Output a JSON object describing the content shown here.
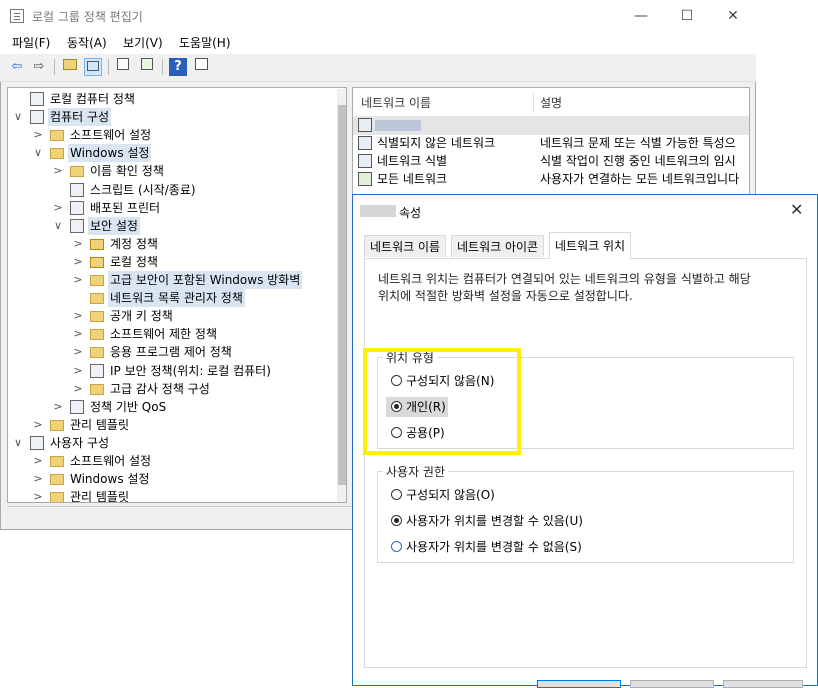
{
  "window": {
    "title": "로컬 그룹 정책 편집기",
    "controls": {
      "minimize": "—",
      "maximize": "☐",
      "close": "✕"
    }
  },
  "menu": [
    "파일(F)",
    "동작(A)",
    "보기(V)",
    "도움말(H)"
  ],
  "toolbar": {
    "icons": [
      "back-icon",
      "forward-icon",
      "up-folder-icon",
      "show-hide-tree-icon",
      "properties-icon",
      "export-icon",
      "help-icon",
      "view-icon"
    ],
    "glyphs": {
      "back": "⇦",
      "forward": "⇨",
      "help": "?"
    }
  },
  "tree": {
    "items": [
      {
        "label": "로컬 컴퓨터 정책",
        "chevron": "",
        "icon": "policy-icon"
      },
      {
        "label": "컴퓨터 구성",
        "chevron": "∨",
        "icon": "computer-icon"
      },
      {
        "label": "소프트웨어 설정",
        "chevron": ">",
        "icon": "folder-icon"
      },
      {
        "label": "Windows 설정",
        "chevron": "∨",
        "icon": "folder-icon"
      },
      {
        "label": "이름 확인 정책",
        "chevron": ">",
        "icon": "folder-icon"
      },
      {
        "label": "스크립트 (시작/종료)",
        "chevron": "",
        "icon": "script-icon"
      },
      {
        "label": "배포된 프린터",
        "chevron": ">",
        "icon": "printer-icon"
      },
      {
        "label": "보안 설정",
        "chevron": "∨",
        "icon": "security-icon"
      },
      {
        "label": "계정 정책",
        "chevron": ">",
        "icon": "folder-lock-icon"
      },
      {
        "label": "로컬 정책",
        "chevron": ">",
        "icon": "folder-lock-icon"
      },
      {
        "label": "고급 보안이 포함된 Windows 방화벽",
        "chevron": ">",
        "icon": "folder-icon"
      },
      {
        "label": "네트워크 목록 관리자 정책",
        "chevron": "",
        "icon": "folder-icon"
      },
      {
        "label": "공개 키 정책",
        "chevron": ">",
        "icon": "folder-icon"
      },
      {
        "label": "소프트웨어 제한 정책",
        "chevron": ">",
        "icon": "folder-icon"
      },
      {
        "label": "응용 프로그램 제어 정책",
        "chevron": ">",
        "icon": "folder-icon"
      },
      {
        "label": "IP 보안 정책(위치: 로컬 컴퓨터)",
        "chevron": ">",
        "icon": "ip-security-icon"
      },
      {
        "label": "고급 감사 정책 구성",
        "chevron": ">",
        "icon": "folder-icon"
      },
      {
        "label": "정책 기반 QoS",
        "chevron": ">",
        "icon": "chart-icon"
      },
      {
        "label": "관리 템플릿",
        "chevron": ">",
        "icon": "folder-icon"
      },
      {
        "label": "사용자 구성",
        "chevron": "∨",
        "icon": "user-icon"
      },
      {
        "label": "소프트웨어 설정",
        "chevron": ">",
        "icon": "folder-icon"
      },
      {
        "label": "Windows 설정",
        "chevron": ">",
        "icon": "folder-icon"
      },
      {
        "label": "관리 템플릿",
        "chevron": ">",
        "icon": "folder-icon"
      }
    ]
  },
  "list": {
    "columns": [
      "네트워크 이름",
      "설명"
    ],
    "rows": [
      {
        "name": "",
        "desc": ""
      },
      {
        "name": "식별되지 않은 네트워크",
        "desc": "네트워크 문제 또는 식별 가능한 특성으"
      },
      {
        "name": "네트워크 식별",
        "desc": "식별 작업이 진행 중인 네트워크의 임시"
      },
      {
        "name": "모든 네트워크",
        "desc": "사용자가 연결하는 모든 네트워크입니다"
      }
    ]
  },
  "dialog": {
    "title": "속성",
    "close": "✕",
    "tabs": [
      "네트워크 이름",
      "네트워크 아이콘",
      "네트워크 위치"
    ],
    "description_line1": "네트워크 위치는 컴퓨터가 연결되어 있는 네트워크의 유형을 식별하고 해당",
    "description_line2": "위치에 적절한 방화벽 설정을 자동으로 설정합니다.",
    "location_group": {
      "label": "위치 유형",
      "options": [
        "구성되지 않음(N)",
        "개인(R)",
        "공용(P)"
      ],
      "selected": "개인(R)"
    },
    "permission_group": {
      "label": "사용자 권한",
      "options": [
        "구성되지 않음(O)",
        "사용자가 위치를 변경할 수 있음(U)",
        "사용자가 위치를 변경할 수 없음(S)"
      ],
      "selected": "사용자가 위치를 변경할 수 있음(U)"
    },
    "highlight_color": "#ffef00"
  }
}
